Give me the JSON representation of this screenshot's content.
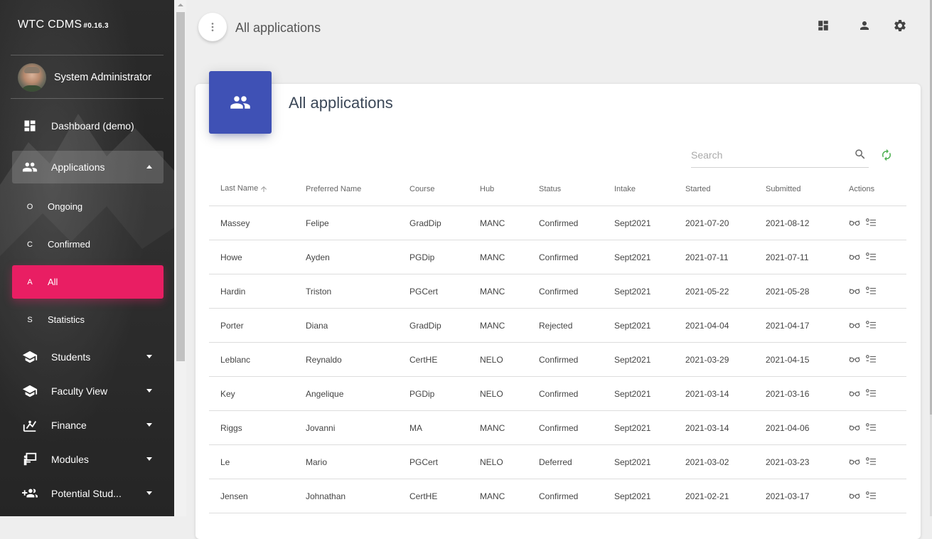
{
  "sidebar": {
    "brand": "WTC CDMS",
    "version": "#0.16.3",
    "user_name": "System Administrator",
    "items": [
      {
        "label": "Dashboard (demo)",
        "icon": "dashboard-icon"
      },
      {
        "label": "Applications",
        "icon": "people-icon",
        "expanded": true
      },
      {
        "label": "Students",
        "icon": "school-icon"
      },
      {
        "label": "Faculty View",
        "icon": "school-icon"
      },
      {
        "label": "Finance",
        "icon": "finance-icon"
      },
      {
        "label": "Modules",
        "icon": "modules-icon"
      },
      {
        "label": "Potential Stud...",
        "icon": "group-add-icon"
      }
    ],
    "subitems": [
      {
        "abbr": "O",
        "label": "Ongoing"
      },
      {
        "abbr": "C",
        "label": "Confirmed"
      },
      {
        "abbr": "A",
        "label": "All",
        "active": true
      },
      {
        "abbr": "S",
        "label": "Statistics"
      }
    ]
  },
  "topbar": {
    "title": "All applications",
    "icons": [
      "dashboard-icon",
      "person-icon",
      "settings-icon"
    ]
  },
  "card": {
    "title": "All applications",
    "search_placeholder": "Search"
  },
  "table": {
    "columns": [
      "Last Name",
      "Preferred Name",
      "Course",
      "Hub",
      "Status",
      "Intake",
      "Started",
      "Submitted",
      "Actions"
    ],
    "rows": [
      [
        "Massey",
        "Felipe",
        "GradDip",
        "MANC",
        "Confirmed",
        "Sept2021",
        "2021-07-20",
        "2021-08-12"
      ],
      [
        "Howe",
        "Ayden",
        "PGDip",
        "MANC",
        "Confirmed",
        "Sept2021",
        "2021-07-11",
        "2021-07-11"
      ],
      [
        "Hardin",
        "Triston",
        "PGCert",
        "MANC",
        "Confirmed",
        "Sept2021",
        "2021-05-22",
        "2021-05-28"
      ],
      [
        "Porter",
        "Diana",
        "GradDip",
        "MANC",
        "Rejected",
        "Sept2021",
        "2021-04-04",
        "2021-04-17"
      ],
      [
        "Leblanc",
        "Reynaldo",
        "CertHE",
        "NELO",
        "Confirmed",
        "Sept2021",
        "2021-03-29",
        "2021-04-15"
      ],
      [
        "Key",
        "Angelique",
        "PGDip",
        "NELO",
        "Confirmed",
        "Sept2021",
        "2021-03-14",
        "2021-03-16"
      ],
      [
        "Riggs",
        "Jovanni",
        "MA",
        "MANC",
        "Confirmed",
        "Sept2021",
        "2021-03-14",
        "2021-04-06"
      ],
      [
        "Le",
        "Mario",
        "PGCert",
        "NELO",
        "Deferred",
        "Sept2021",
        "2021-03-02",
        "2021-03-23"
      ],
      [
        "Jensen",
        "Johnathan",
        "CertHE",
        "MANC",
        "Confirmed",
        "Sept2021",
        "2021-02-21",
        "2021-03-17"
      ]
    ]
  },
  "colors": {
    "active_nav": "#e91e63",
    "card_icon_bg": "#3f51b5",
    "refresh": "#4caf50"
  }
}
